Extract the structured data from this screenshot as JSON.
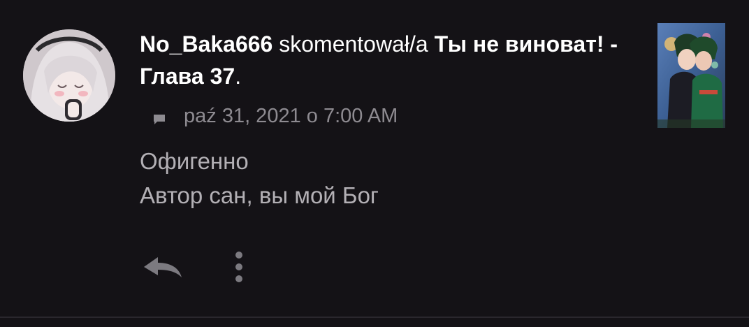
{
  "comment": {
    "username": "No_Baka666",
    "action_text": "skomentował/a",
    "story_title": "Ты не виноват! - Глава 37",
    "title_suffix": ".",
    "timestamp": "paź 31, 2021 o 7:00 AM",
    "body_lines": [
      "Офигенно",
      "Автор сан, вы мой Бог"
    ]
  },
  "icons": {
    "meta": "comment-icon",
    "reply": "reply-arrow-icon",
    "more": "more-vertical-icon"
  },
  "colors": {
    "background": "#141216",
    "primary_text": "#ffffff",
    "secondary_text": "#8e8b91",
    "body_text": "#b3b0b5"
  }
}
